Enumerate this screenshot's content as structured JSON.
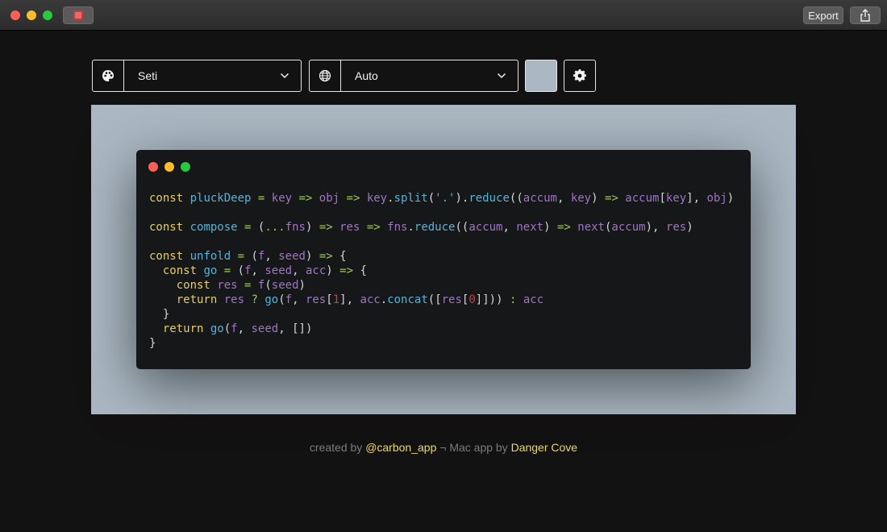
{
  "titlebar": {
    "export_label": "Export",
    "icons": {
      "app": "carbon-app-icon",
      "share": "share-icon"
    }
  },
  "toolbar": {
    "theme": {
      "value": "Seti",
      "icon": "palette-icon"
    },
    "language": {
      "value": "Auto",
      "icon": "globe-icon"
    },
    "background_color": "#abb8c3",
    "settings_icon": "gear-icon"
  },
  "editor": {
    "background": "#151718",
    "lines": [
      "const pluckDeep = key => obj => key.split('.').reduce((accum, key) => accum[key], obj)",
      "",
      "const compose = (...fns) => res => fns.reduce((accum, next) => next(accum), res)",
      "",
      "const unfold = (f, seed) => {",
      "  const go = (f, seed, acc) => {",
      "    const res = f(seed)",
      "    return res ? go(f, res[1], acc.concat([res[0]])) : acc",
      "  }",
      "  return go(f, seed, [])",
      "}"
    ]
  },
  "footer": {
    "prefix": "created by ",
    "link1": "@carbon_app",
    "middle": " ¬ Mac app by ",
    "link2": "Danger Cove"
  }
}
